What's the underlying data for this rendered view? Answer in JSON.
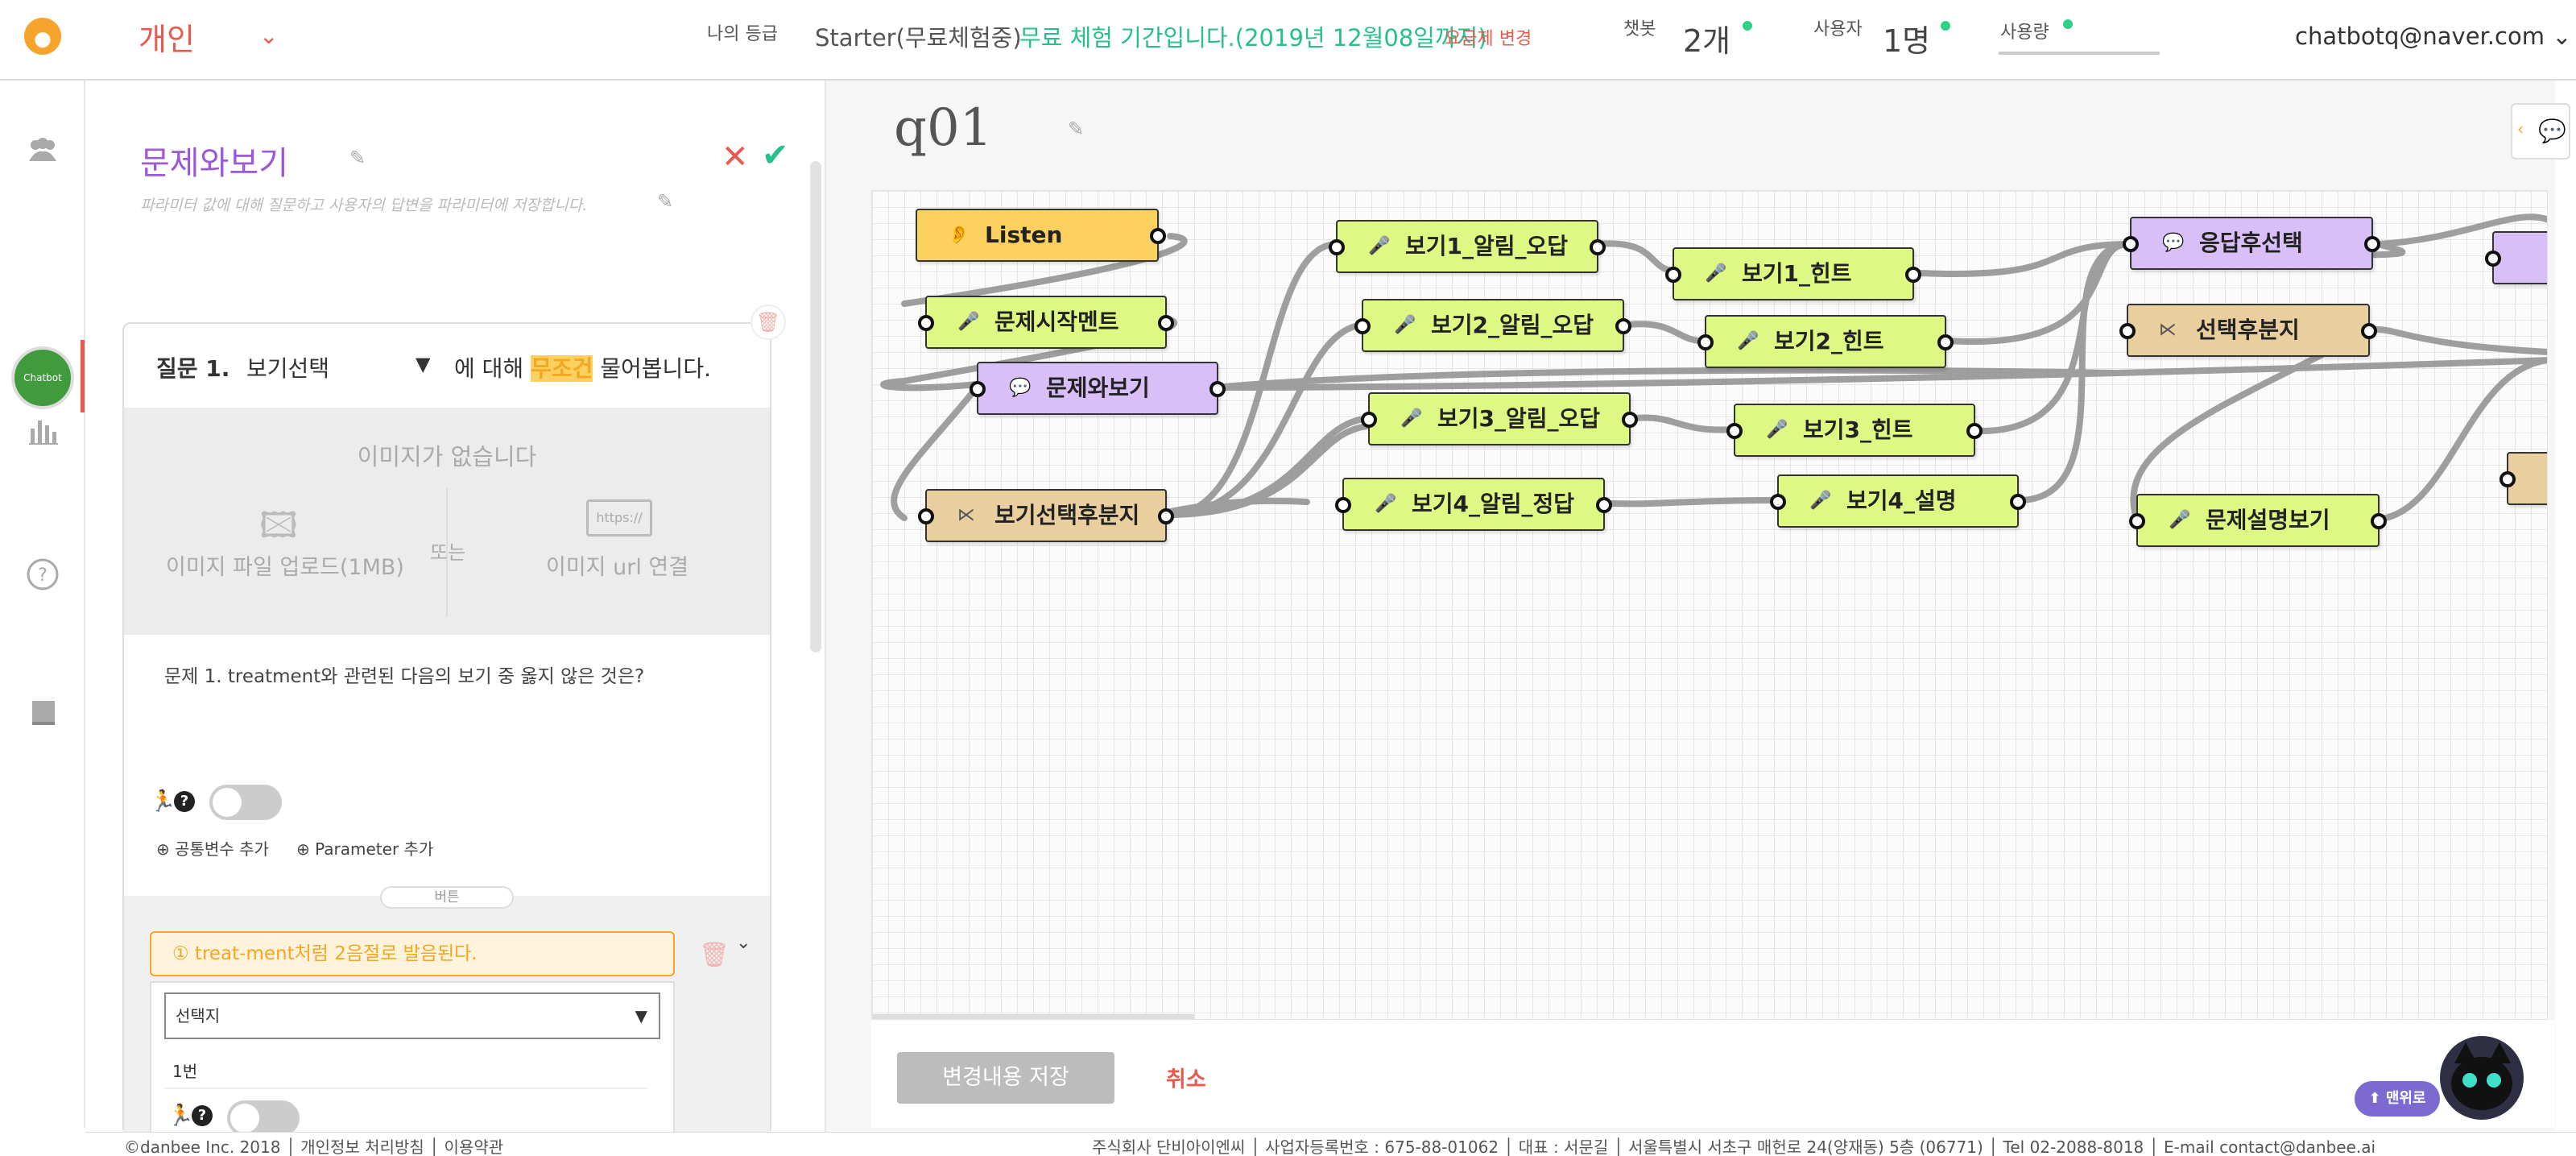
{
  "header": {
    "workspace": "개인",
    "grade_label": "나의 등급",
    "plan": "Starter(무료체험중)",
    "trial_notice": "무료 체험 기간입니다.(2019년 12월08일까지)",
    "plan_change": "요금제 변경",
    "chatbot_label": "챗봇",
    "chatbot_count": "2개",
    "user_label": "사용자",
    "user_count": "1명",
    "usage_label": "사용량",
    "account": "chatbotq@naver.com"
  },
  "rail": {
    "items": [
      "people-icon",
      "chatbot-avatar",
      "chart-icon",
      "help-icon",
      "book-icon"
    ],
    "avatar_text": "Chatbot"
  },
  "panel": {
    "title": "문제와보기",
    "subtitle": "파라미터 값에 대해 질문하고 사용자의 답변을 파라미터에 저장합니다.",
    "question_prefix": "질문 1.",
    "question_select": "보기선택",
    "question_mid": "에 대해",
    "question_condition": "무조건",
    "question_suffix": "물어봅니다.",
    "image_none": "이미지가 없습니다",
    "image_upload": "이미지 파일 업로드(1MB)",
    "image_or": "또는",
    "image_url": "이미지 url 연결",
    "url_badge": "https://",
    "question_text": "문제 1. treatment와 관련된 다음의 보기 중 옳지 않은 것은?",
    "add_common_var": "공통변수 추가",
    "add_parameter": "Parameter 추가",
    "button_section_label": "버튼",
    "hint_text": "① treat-ment처럼 2음절로 발음된다.",
    "choice_select": "선택지",
    "choice_value": "1번"
  },
  "canvas": {
    "page_title": "q01",
    "nodes": [
      {
        "id": "listen",
        "label": "Listen",
        "kind": "orange",
        "icon": "ear-icon"
      },
      {
        "id": "intro",
        "label": "문제시작멘트",
        "kind": "green",
        "icon": "mic-icon"
      },
      {
        "id": "qview",
        "label": "문제와보기",
        "kind": "purple",
        "icon": "chat-icon"
      },
      {
        "id": "branch1",
        "label": "보기선택후분지",
        "kind": "tan",
        "icon": "branch-icon"
      },
      {
        "id": "v1wrong",
        "label": "보기1_알림_오답",
        "kind": "green",
        "icon": "mic-icon"
      },
      {
        "id": "v2wrong",
        "label": "보기2_알림_오답",
        "kind": "green",
        "icon": "mic-icon"
      },
      {
        "id": "v3wrong",
        "label": "보기3_알림_오답",
        "kind": "green",
        "icon": "mic-icon"
      },
      {
        "id": "v4right",
        "label": "보기4_알림_정답",
        "kind": "green",
        "icon": "mic-icon"
      },
      {
        "id": "v1hint",
        "label": "보기1_힌트",
        "kind": "green",
        "icon": "mic-icon"
      },
      {
        "id": "v2hint",
        "label": "보기2_힌트",
        "kind": "green",
        "icon": "mic-icon"
      },
      {
        "id": "v3hint",
        "label": "보기3_힌트",
        "kind": "green",
        "icon": "mic-icon"
      },
      {
        "id": "v4expl",
        "label": "보기4_설명",
        "kind": "green",
        "icon": "mic-icon"
      },
      {
        "id": "after",
        "label": "응답후선택",
        "kind": "purple",
        "icon": "chat-icon"
      },
      {
        "id": "branch2",
        "label": "선택후분지",
        "kind": "tan",
        "icon": "branch-icon"
      },
      {
        "id": "explain",
        "label": "문제설명보기",
        "kind": "green",
        "icon": "mic-icon"
      }
    ],
    "save_button": "변경내용 저장",
    "cancel_button": "취소",
    "to_top": "맨위로"
  },
  "footer": {
    "left": "©danbee Inc. 2018 │ 개인정보 처리방침 │ 이용약관",
    "right": "주식회사 단비아이엔씨 │ 사업자등록번호 : 675-88-01062 │ 대표 : 서문길 │ 서울특별시 서초구 매헌로 24(양재동) 5층 (06771) │ Tel 02-2088-8018 │ E-mail contact@danbee.ai"
  },
  "colors": {
    "accent_red": "#e85a4f",
    "accent_green": "#27c08a",
    "accent_purple": "#9b59d6",
    "accent_orange": "#f5a623"
  }
}
